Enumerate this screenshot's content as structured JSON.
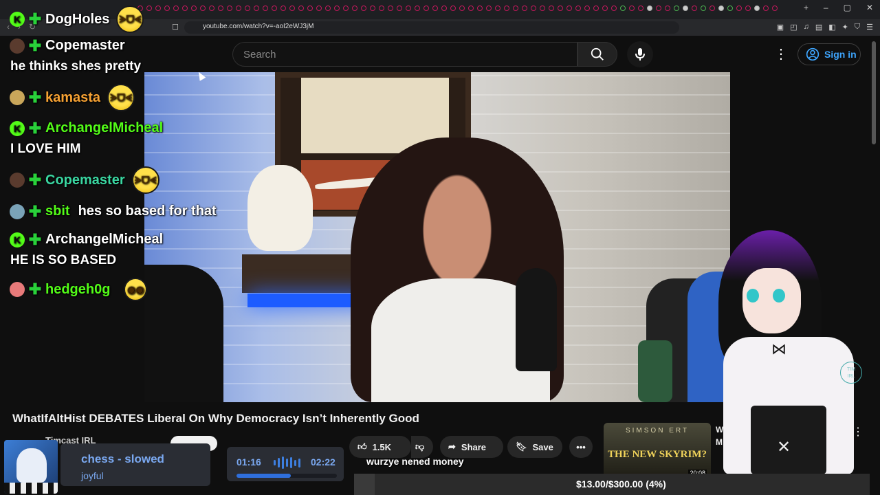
{
  "browser": {
    "url": "youtube.com/watch?v=-aoI2eWJ3jM"
  },
  "yt_header": {
    "search_placeholder": "Search",
    "sign_in": "Sign in"
  },
  "chat": {
    "messages": [
      {
        "user": "DogHoles",
        "text": ""
      },
      {
        "user": "Copemaster",
        "text": "he thinks shes pretty"
      },
      {
        "user": "kamasta",
        "text": ""
      },
      {
        "user": "ArchangelMicheal",
        "text": "I LOVE HIM"
      },
      {
        "user": "Copemaster",
        "text": ""
      },
      {
        "user": "sbit",
        "text": "hes so based for that"
      },
      {
        "user": "ArchangelMicheal",
        "text": "HE IS SO BASED"
      },
      {
        "user": "hedgeh0g",
        "text": ""
      }
    ]
  },
  "video": {
    "title": "WhatIfAltHist DEBATES Liberal On Why Democracy Isn’t Inherently Good",
    "channel": "Timcast IRL",
    "likes": "1.5K",
    "share_label": "Share",
    "save_label": "Save"
  },
  "recommended": {
    "thumb_header": "SIMSON  ERT",
    "thumb_title": "THE NEW SKYRIM?",
    "duration": "20:08",
    "text_line1": "W",
    "text_line2": "M"
  },
  "music": {
    "title": "chess - slowed",
    "artist": "joyful",
    "time_current": "01:16",
    "time_total": "02:22",
    "progress": 0.54
  },
  "ticker": "wurzye nened money",
  "goal": {
    "text": "$13.00/$300.00 (4%)",
    "fraction": 0.04
  },
  "colors": {
    "kick_green": "#53fc18",
    "yt_link_blue": "#3ea6ff",
    "music_blue": "#7aa8f0"
  }
}
